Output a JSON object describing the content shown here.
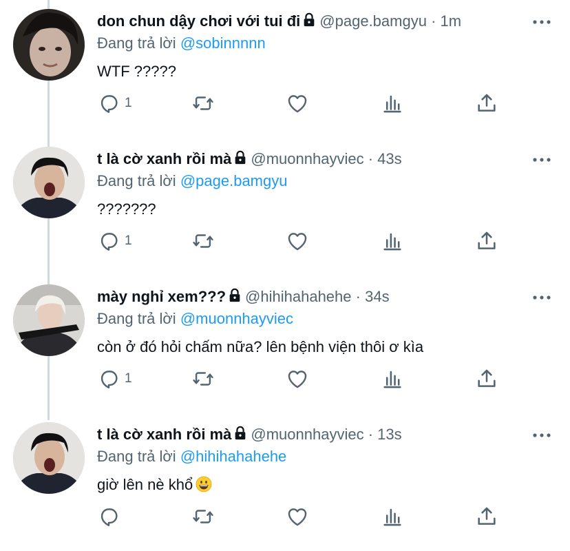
{
  "reply_prefix": "Đang trả lời",
  "separator": "·",
  "tweets": [
    {
      "name": "don chun dậy chơi với tui đi",
      "handle": "@page.bamgyu",
      "time": "1m",
      "reply_to": "@sobinnnnn",
      "text": "WTF ?????",
      "reply_count": "1"
    },
    {
      "name": "t là cờ xanh rồi mà",
      "handle": "@muonnhayviec",
      "time": "43s",
      "reply_to": "@page.bamgyu",
      "text": "???????",
      "reply_count": "1"
    },
    {
      "name": "mày nghỉ xem???",
      "handle": "@hihihahahehe",
      "time": "34s",
      "reply_to": "@muonnhayviec",
      "text": "còn ở đó hỏi chấm nữa? lên bệnh viện thôi ơ kìa",
      "reply_count": "1"
    },
    {
      "name": "t là cờ xanh rồi mà",
      "handle": "@muonnhayviec",
      "time": "13s",
      "reply_to": "@hihihahahehe",
      "text": "giờ lên nè khổ",
      "reply_count": ""
    }
  ],
  "icons": {
    "lock": "lock-icon",
    "more": "more-icon",
    "reply": "reply-icon",
    "retweet": "retweet-icon",
    "like": "heart-icon",
    "views": "views-icon",
    "share": "share-icon",
    "emoji": "grinning-face-emoji"
  },
  "colors": {
    "mention": "#1d9bf0",
    "secondary_text": "#536471",
    "thread_line": "#cfd9de"
  }
}
